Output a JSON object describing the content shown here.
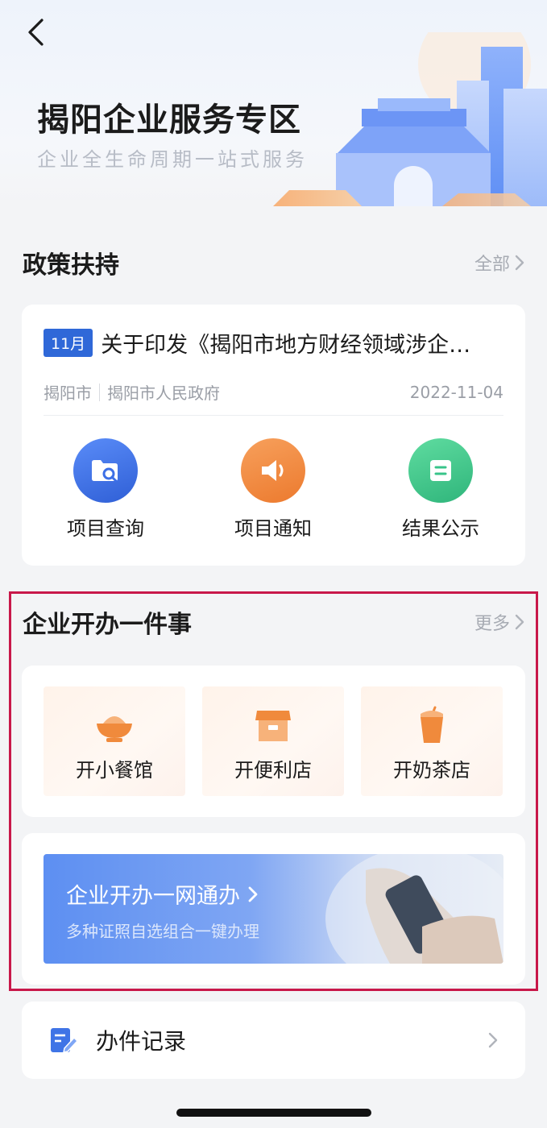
{
  "header": {
    "title": "揭阳企业服务专区",
    "subtitle": "企业全生命周期一站式服务"
  },
  "policy": {
    "section_title": "政策扶持",
    "more_label": "全部",
    "item": {
      "month_badge": "11月",
      "title": "关于印发《揭阳市地方财经领域涉企…",
      "source_city": "揭阳市",
      "source_org": "揭阳市人民政府",
      "date": "2022-11-04"
    },
    "quick_actions": [
      {
        "label": "项目查询",
        "icon": "folder-search-icon",
        "color": "#3c6fe6"
      },
      {
        "label": "项目通知",
        "icon": "speaker-icon",
        "color": "#f08a3c"
      },
      {
        "label": "结果公示",
        "icon": "document-icon",
        "color": "#38c48a"
      }
    ]
  },
  "startup": {
    "section_title": "企业开办一件事",
    "more_label": "更多",
    "tiles": [
      {
        "label": "开小餐馆",
        "icon": "bowl-icon"
      },
      {
        "label": "开便利店",
        "icon": "shop-icon"
      },
      {
        "label": "开奶茶店",
        "icon": "milk-tea-icon"
      }
    ],
    "banner": {
      "title": "企业开办一网通办",
      "subtitle": "多种证照自选组合一键办理"
    }
  },
  "records": {
    "label": "办件记录",
    "icon": "edit-document-icon"
  },
  "colors": {
    "accent_blue": "#2f68d8",
    "highlight_border": "#c8184a",
    "tile_orange": "#f08a3c"
  }
}
